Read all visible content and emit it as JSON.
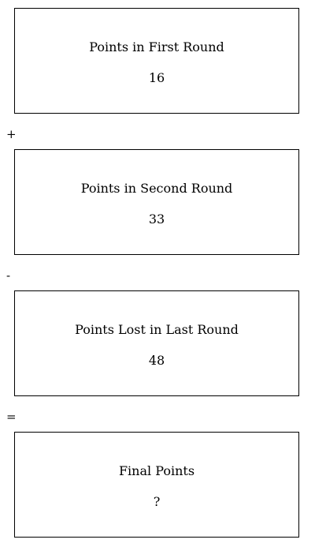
{
  "boxes": [
    {
      "label": "Points in First Round",
      "value": "16"
    },
    {
      "label": "Points in Second Round",
      "value": "33"
    },
    {
      "label": "Points Lost in Last Round",
      "value": "48"
    },
    {
      "label": "Final Points",
      "value": "?"
    }
  ],
  "operators": [
    "+",
    "-",
    "="
  ]
}
